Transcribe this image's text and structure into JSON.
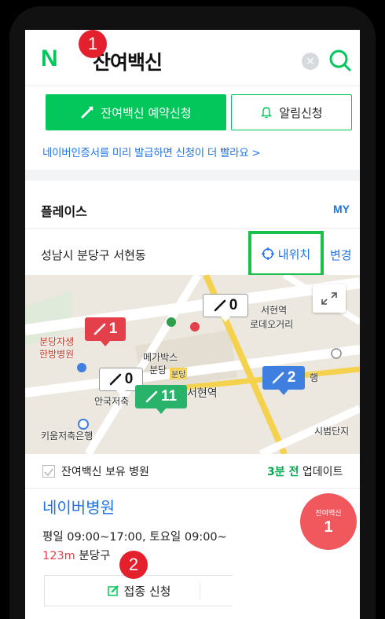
{
  "header": {
    "logo": "N",
    "title": "잔여백신",
    "clear_glyph": "×"
  },
  "markers": {
    "one": "1",
    "two": "2"
  },
  "actions": {
    "reserve_label": "잔여백신 예약신청",
    "alarm_label": "알림신청"
  },
  "cert_link": "네이버인증서를 미리 발급하면 신청이 더 빨라요 >",
  "place": {
    "title": "플레이스",
    "my": "MY",
    "location": "성남시 분당구 서현동",
    "my_location": "내위치",
    "change": "변경"
  },
  "map": {
    "labels": {
      "seohyeon_station": "서현역",
      "rodeo": "로데오거리",
      "bundang_hospital_1": "분당자생",
      "bundang_hospital_2": "한방병원",
      "megabox_1": "메가박스",
      "megabox_2": "분당",
      "seohyeon_center": "서현역",
      "anguk": "안국저축",
      "kiwoom": "키움저축은행",
      "sibeom": "시범단지",
      "bank": "행",
      "bundang_badge": "분당"
    },
    "pins": {
      "top_white": "0",
      "red": "1",
      "mid_white": "0",
      "green": "11",
      "blue": "2"
    }
  },
  "list": {
    "own_label": "잔여백신 보유 병원",
    "update_time": "3분 전",
    "update_suffix": " 업데이트",
    "hospital_name": "네이버병원",
    "hours": "평일 09:00~17:00, 토요일 09:00~",
    "distance": "123m",
    "district": "분당구",
    "badge_label": "잔여백신",
    "badge_count": "1",
    "apply_label": "접종 신청"
  },
  "colors": {
    "brand_green": "#03c75a",
    "link_blue": "#1f73e8",
    "highlight_green": "#19c14b",
    "alert_red": "#e4202d"
  }
}
